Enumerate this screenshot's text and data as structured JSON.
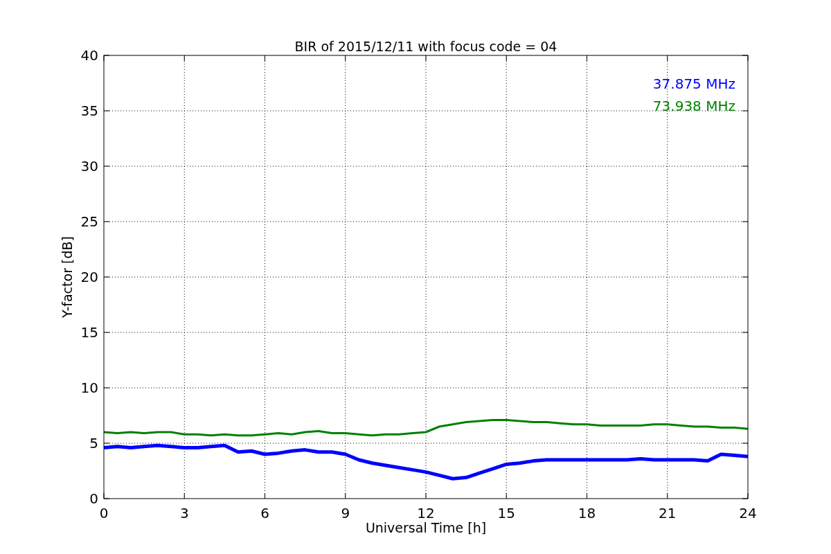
{
  "chart_data": {
    "type": "line",
    "title": "BIR of 2015/12/11 with focus code = 04",
    "xlabel": "Universal Time [h]",
    "ylabel": "Y-factor [dB]",
    "x": [
      0,
      0.5,
      1,
      1.5,
      2,
      2.5,
      3,
      3.5,
      4,
      4.5,
      5,
      5.5,
      6,
      6.5,
      7,
      7.5,
      8,
      8.5,
      9,
      9.5,
      10,
      10.5,
      11,
      11.5,
      12,
      12.5,
      13,
      13.5,
      14,
      14.5,
      15,
      15.5,
      16,
      16.5,
      17,
      17.5,
      18,
      18.5,
      19,
      19.5,
      20,
      20.5,
      21,
      21.5,
      22,
      22.5,
      23,
      23.5,
      24
    ],
    "series": [
      {
        "name": "37.875 MHz",
        "color": "#0000ff",
        "values": [
          4.6,
          4.7,
          4.6,
          4.7,
          4.8,
          4.7,
          4.6,
          4.6,
          4.7,
          4.8,
          4.2,
          4.3,
          4.0,
          4.1,
          4.3,
          4.4,
          4.2,
          4.2,
          4.0,
          3.5,
          3.2,
          3.0,
          2.8,
          2.6,
          2.4,
          2.1,
          1.8,
          1.9,
          2.3,
          2.7,
          3.1,
          3.2,
          3.4,
          3.5,
          3.5,
          3.5,
          3.5,
          3.5,
          3.5,
          3.5,
          3.6,
          3.5,
          3.5,
          3.5,
          3.5,
          3.4,
          4.0,
          3.9,
          3.8
        ]
      },
      {
        "name": "73.938 MHz",
        "color": "#008000",
        "values": [
          6.0,
          5.9,
          6.0,
          5.9,
          6.0,
          6.0,
          5.8,
          5.8,
          5.7,
          5.8,
          5.7,
          5.7,
          5.8,
          5.9,
          5.8,
          6.0,
          6.1,
          5.9,
          5.9,
          5.8,
          5.7,
          5.8,
          5.8,
          5.9,
          6.0,
          6.5,
          6.7,
          6.9,
          7.0,
          7.1,
          7.1,
          7.0,
          6.9,
          6.9,
          6.8,
          6.7,
          6.7,
          6.6,
          6.6,
          6.6,
          6.6,
          6.7,
          6.7,
          6.6,
          6.5,
          6.5,
          6.4,
          6.4,
          6.3
        ]
      }
    ],
    "grid": true,
    "xlim": [
      0,
      24
    ],
    "ylim": [
      0,
      40
    ],
    "xticks": [
      0,
      3,
      6,
      9,
      12,
      15,
      18,
      21,
      24
    ],
    "yticks": [
      0,
      5,
      10,
      15,
      20,
      25,
      30,
      35,
      40
    ]
  }
}
